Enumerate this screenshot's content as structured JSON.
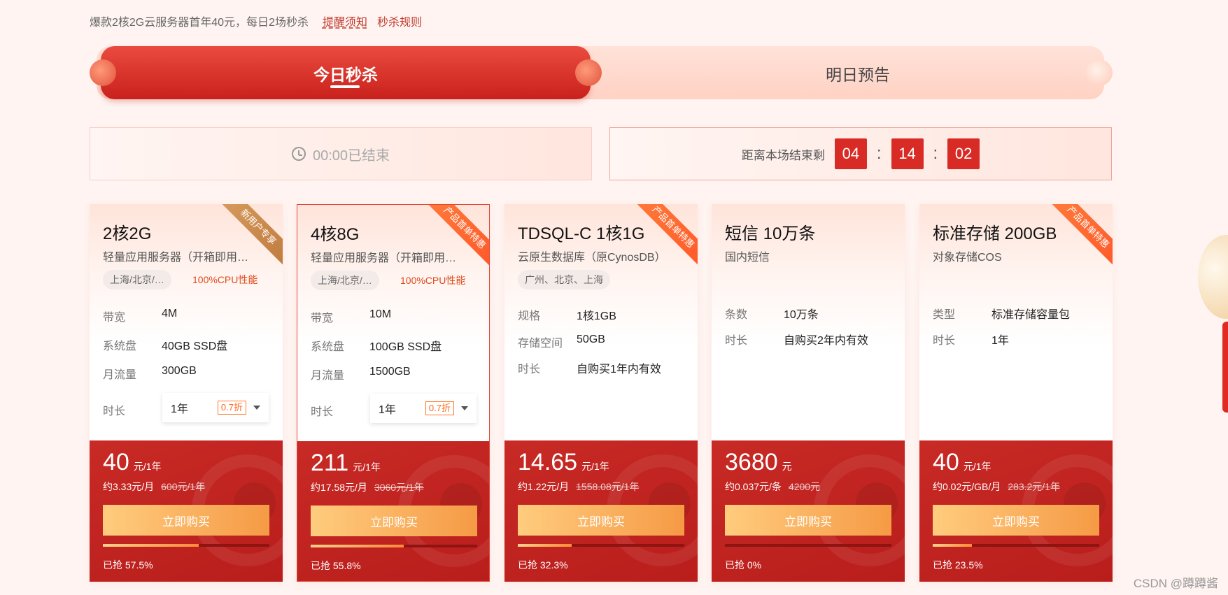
{
  "topbar": {
    "promo": "爆款2核2G云服务器首年40元，每日2场秒杀",
    "tip_link": "提醒须知",
    "rule_link": "秒杀规则"
  },
  "tabs": {
    "today": "今日秒杀",
    "tomorrow": "明日预告"
  },
  "status": {
    "ended_session": "00:00已结束",
    "countdown_label": "距离本场结束剩",
    "countdown_hours": "04",
    "countdown_minutes": "14",
    "countdown_seconds": "02",
    "separator": ":"
  },
  "cards": [
    {
      "ribbon": "新用户专享",
      "name": "2核2G",
      "desc": "轻量应用服务器（开箱即用…",
      "region": "上海/北京/…",
      "cpu": "100%CPU性能",
      "specs": [
        {
          "k": "带宽",
          "v": "4M"
        },
        {
          "k": "系统盘",
          "v": "40GB SSD盘"
        },
        {
          "k": "月流量",
          "v": "300GB"
        }
      ],
      "duration_label": "时长",
      "duration_value": "1年",
      "discount": "0.7折",
      "price": "40",
      "price_unit": "元/1年",
      "per": "约3.33元/月",
      "orig": "600元/1年",
      "buy": "立即购买",
      "progress": 57.5,
      "sold": "已抢 57.5%"
    },
    {
      "ribbon": "产品首单特惠",
      "name": "4核8G",
      "desc": "轻量应用服务器（开箱即用…",
      "region": "上海/北京/…",
      "cpu": "100%CPU性能",
      "specs": [
        {
          "k": "带宽",
          "v": "10M"
        },
        {
          "k": "系统盘",
          "v": "100GB SSD盘"
        },
        {
          "k": "月流量",
          "v": "1500GB"
        }
      ],
      "duration_label": "时长",
      "duration_value": "1年",
      "discount": "0.7折",
      "price": "211",
      "price_unit": "元/1年",
      "per": "约17.58元/月",
      "orig": "3060元/1年",
      "buy": "立即购买",
      "progress": 55.8,
      "sold": "已抢 55.8%"
    },
    {
      "ribbon": "产品首单特惠",
      "name": "TDSQL-C 1核1G",
      "desc": "云原生数据库（原CynosDB）",
      "region": "广州、北京、上海",
      "specs": [
        {
          "k": "规格",
          "v": "1核1GB"
        },
        {
          "k": "存储空间",
          "v": "50GB"
        },
        {
          "k": "时长",
          "v": "自购买1年内有效"
        }
      ],
      "price": "14.65",
      "price_unit": "元/1年",
      "per": "约1.22元/月",
      "orig": "1558.08元/1年",
      "buy": "立即购买",
      "progress": 32.3,
      "sold": "已抢 32.3%"
    },
    {
      "name": "短信 10万条",
      "desc": "国内短信",
      "specs": [
        {
          "k": "条数",
          "v": "10万条"
        },
        {
          "k": "时长",
          "v": "自购买2年内有效"
        }
      ],
      "price": "3680",
      "price_unit": "元",
      "per": "约0.037元/条",
      "orig": "4200元",
      "buy": "立即购买",
      "progress": 0,
      "sold": "已抢 0%"
    },
    {
      "ribbon": "产品首单特惠",
      "name": "标准存储 200GB",
      "desc": "对象存储COS",
      "specs": [
        {
          "k": "类型",
          "v": "标准存储容量包"
        },
        {
          "k": "时长",
          "v": "1年"
        }
      ],
      "price": "40",
      "price_unit": "元/1年",
      "per": "约0.02元/GB/月",
      "orig": "283.2元/1年",
      "buy": "立即购买",
      "progress": 23.5,
      "sold": "已抢 23.5%"
    }
  ],
  "watermark": "CSDN @蹲蹲酱"
}
